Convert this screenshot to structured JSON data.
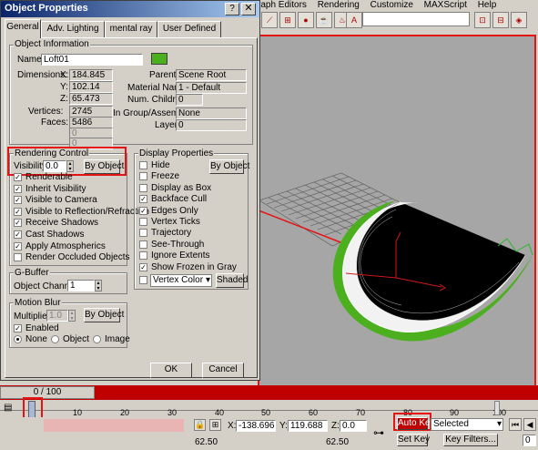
{
  "menubar": [
    "raph Editors",
    "Rendering",
    "Customize",
    "MAXScript",
    "Help"
  ],
  "dialog": {
    "title": "Object Properties",
    "tabs": [
      "General",
      "Adv. Lighting",
      "mental ray",
      "User Defined"
    ],
    "object_info": {
      "group_label": "Object Information",
      "name_label": "Name:",
      "name_value": "Loft01",
      "color": "#4caf1e",
      "dimensions_label": "Dimensions:",
      "x_label": "X:",
      "x_value": "184.845",
      "y_label": "Y:",
      "y_value": "102.14",
      "z_label": "Z:",
      "z_value": "65.473",
      "vertices_label": "Vertices:",
      "vertices_value": "2745",
      "faces_label": "Faces:",
      "faces_value": "5486",
      "extra1": "0",
      "extra2": "0",
      "parent_label": "Parent:",
      "parent_value": "Scene Root",
      "material_label": "Material Name:",
      "material_value": "1 - Default",
      "children_label": "Num. Children:",
      "children_value": "0",
      "group_asm_label": "In Group/Assembly:",
      "group_asm_value": "None",
      "layer_label": "Layer:",
      "layer_value": "0"
    },
    "rendering_control": {
      "group_label": "Rendering Control",
      "visibility_label": "Visibility:",
      "visibility_value": "0.0",
      "by_object": "By Object",
      "checks": [
        {
          "label": "Renderable",
          "checked": true
        },
        {
          "label": "Inherit Visibility",
          "checked": true
        },
        {
          "label": "Visible to Camera",
          "checked": true
        },
        {
          "label": "Visible to Reflection/Refraction",
          "checked": true
        },
        {
          "label": "Receive Shadows",
          "checked": true
        },
        {
          "label": "Cast Shadows",
          "checked": true
        },
        {
          "label": "Apply Atmospherics",
          "checked": true
        },
        {
          "label": "Render Occluded Objects",
          "checked": false
        }
      ]
    },
    "display_properties": {
      "group_label": "Display Properties",
      "by_object": "By Object",
      "checks": [
        {
          "label": "Hide",
          "checked": false
        },
        {
          "label": "Freeze",
          "checked": false
        },
        {
          "label": "Display as Box",
          "checked": false
        },
        {
          "label": "Backface Cull",
          "checked": true
        },
        {
          "label": "Edges Only",
          "checked": true
        },
        {
          "label": "Vertex Ticks",
          "checked": false
        },
        {
          "label": "Trajectory",
          "checked": false
        },
        {
          "label": "See-Through",
          "checked": false
        },
        {
          "label": "Ignore Extents",
          "checked": false
        },
        {
          "label": "Show Frozen in Gray",
          "checked": true
        }
      ],
      "vertex_color": "Vertex Color",
      "shaded": "Shaded"
    },
    "gbuffer": {
      "group_label": "G-Buffer",
      "channel_label": "Object Channel:",
      "channel_value": "1"
    },
    "motion_blur": {
      "group_label": "Motion Blur",
      "multiplier_label": "Multiplier:",
      "multiplier_value": "1.0",
      "by_object": "By Object",
      "enabled_label": "Enabled",
      "radios": [
        {
          "label": "None",
          "on": true
        },
        {
          "label": "Object",
          "on": false
        },
        {
          "label": "Image",
          "on": false
        }
      ]
    },
    "ok": "OK",
    "cancel": "Cancel"
  },
  "timeline": {
    "slider_text": "0 / 100",
    "ticks": [
      "0",
      "10",
      "20",
      "30",
      "40",
      "50",
      "60",
      "70",
      "80",
      "90",
      "100"
    ]
  },
  "status": {
    "x_label": "X:",
    "x_value": "-138.696",
    "y_label": "Y:",
    "y_value": "119.688",
    "z_label": "Z:",
    "z_value": "0.0",
    "auto_key": "Auto Key",
    "selected": "Selected",
    "set_key": "Set Key",
    "key_filters": "Key Filters...",
    "val1": "62.50",
    "val2": "62.50",
    "frame": "0"
  }
}
